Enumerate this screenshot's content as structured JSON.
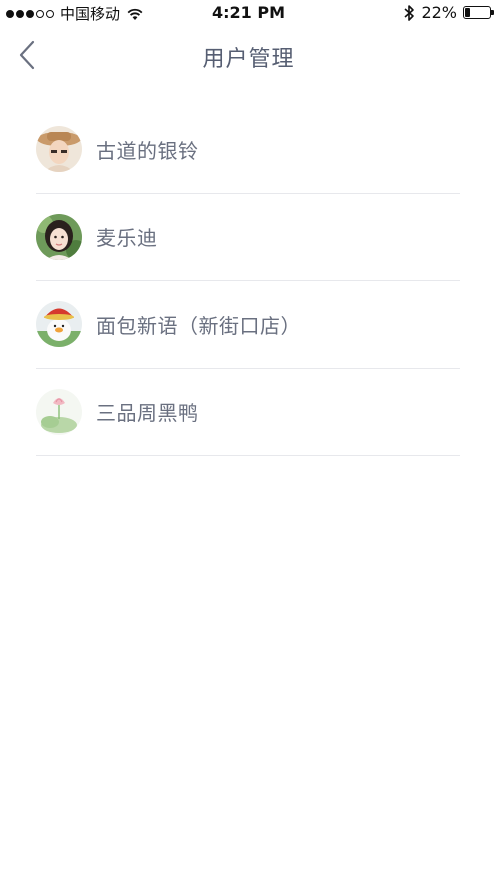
{
  "status_bar": {
    "carrier": "中国移动",
    "time": "4:21 PM",
    "battery_text": "22%",
    "battery_level": 0.22,
    "signal_filled": 3,
    "signal_total": 5
  },
  "nav": {
    "back_icon": "chevron-left-icon",
    "title": "用户管理"
  },
  "users": [
    {
      "name": "古道的银铃",
      "avatar": "avatar-photo-man-hat"
    },
    {
      "name": "麦乐迪",
      "avatar": "avatar-photo-woman"
    },
    {
      "name": "面包新语（新街口店）",
      "avatar": "avatar-cartoon-duck-red-hat"
    },
    {
      "name": "三品周黑鸭",
      "avatar": "avatar-lotus-painting"
    }
  ],
  "colors": {
    "title": "#565e72",
    "item_text": "#6a7080",
    "divider": "#e7e8ec",
    "background": "#ffffff"
  }
}
